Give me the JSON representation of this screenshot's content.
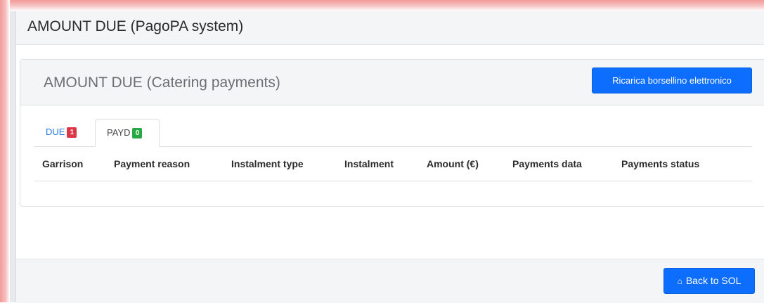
{
  "page": {
    "title": "AMOUNT DUE (PagoPA system)"
  },
  "card": {
    "title": "AMOUNT DUE (Catering payments)",
    "reload_button_label": "Ricarica borsellino elettronico"
  },
  "tabs": [
    {
      "label": "DUE",
      "badge": "1",
      "badge_color": "#dc3545",
      "active": false
    },
    {
      "label": "PAYD",
      "badge": "0",
      "badge_color": "#28a745",
      "active": true
    }
  ],
  "table": {
    "columns": [
      "Garrison",
      "Payment reason",
      "Instalment type",
      "Instalment",
      "Amount (€)",
      "Payments data",
      "Payments status"
    ],
    "rows": []
  },
  "footer": {
    "back_button_label": "Back to SOL",
    "back_button_icon": "home-icon"
  },
  "colors": {
    "primary": "#0d6efd",
    "frame_glow": "#f29a9a"
  }
}
